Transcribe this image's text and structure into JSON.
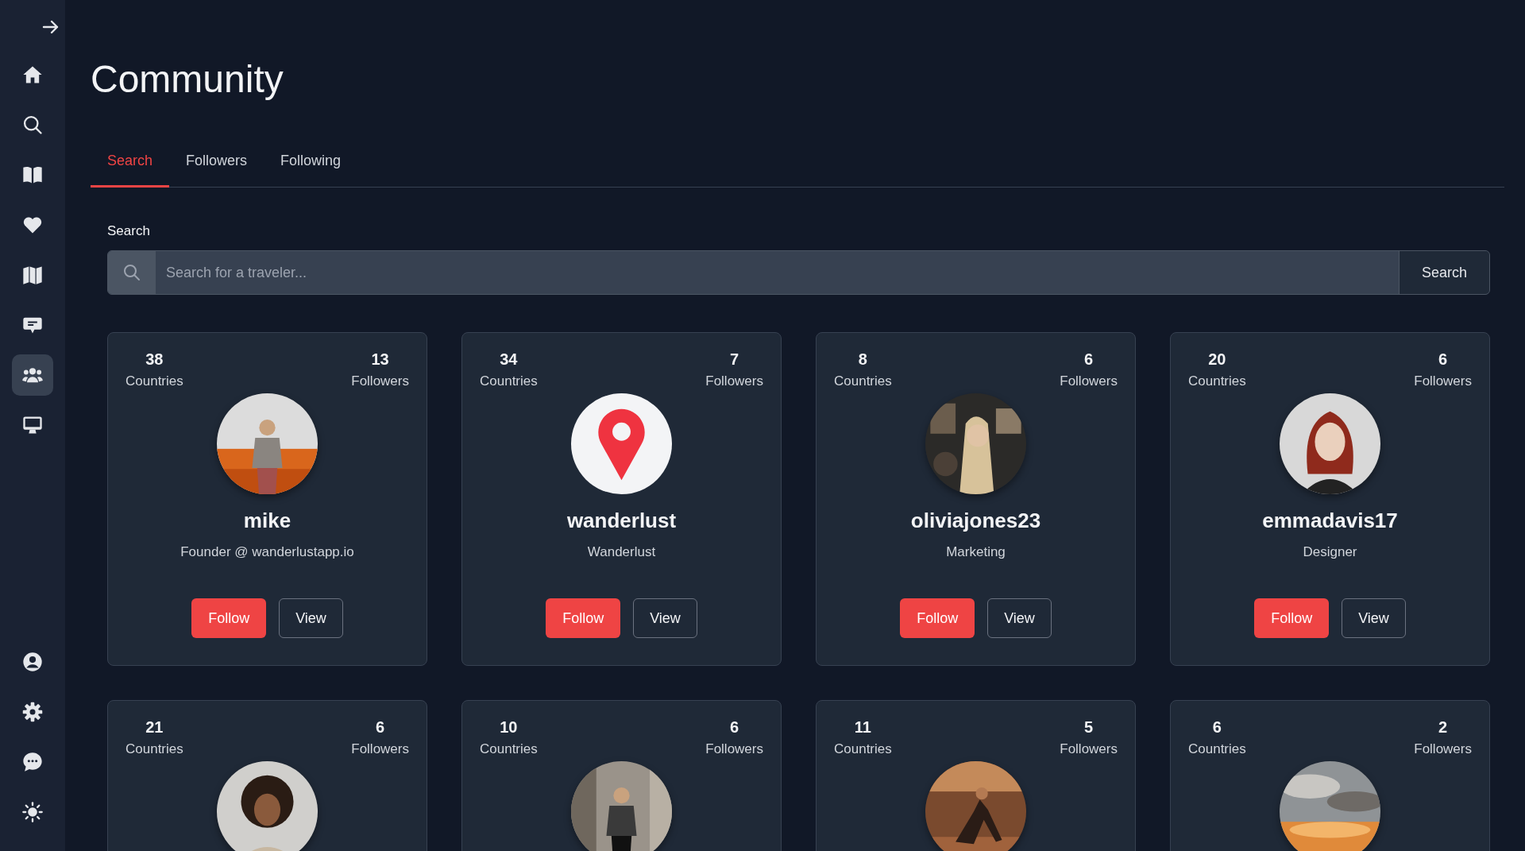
{
  "sidebar": {
    "items": [
      {
        "selected": false
      },
      {
        "selected": false
      },
      {
        "selected": false
      },
      {
        "selected": false
      },
      {
        "selected": false
      },
      {
        "selected": false
      },
      {
        "selected": true
      },
      {
        "selected": false
      }
    ]
  },
  "title": "Community",
  "tabs": [
    {
      "label": "Search",
      "selected": true
    },
    {
      "label": "Followers",
      "selected": false
    },
    {
      "label": "Following",
      "selected": false
    }
  ],
  "search": {
    "label": "Search",
    "placeholder": "Search for a traveler...",
    "button": "Search"
  },
  "users": [
    {
      "countries": "38",
      "countries_label": "Countries",
      "followers": "13",
      "followers_label": "Followers",
      "name": "mike",
      "subtitle": "Founder @ wanderlustapp.io",
      "follow": "Follow",
      "view": "View"
    },
    {
      "countries": "34",
      "countries_label": "Countries",
      "followers": "7",
      "followers_label": "Followers",
      "avatar": {
        "kind": "logo"
      },
      "name": "wanderlust",
      "subtitle": "Wanderlust",
      "follow": "Follow",
      "view": "View"
    },
    {
      "countries": "8",
      "countries_label": "Countries",
      "followers": "6",
      "followers_label": "Followers",
      "name": "oliviajones23",
      "subtitle": "Marketing",
      "follow": "Follow",
      "view": "View"
    },
    {
      "countries": "20",
      "countries_label": "Countries",
      "followers": "6",
      "followers_label": "Followers",
      "name": "emmadavis17",
      "subtitle": "Designer",
      "follow": "Follow",
      "view": "View"
    },
    {
      "countries": "21",
      "countries_label": "Countries",
      "followers": "6",
      "followers_label": "Followers"
    },
    {
      "countries": "10",
      "countries_label": "Countries",
      "followers": "6",
      "followers_label": "Followers"
    },
    {
      "countries": "11",
      "countries_label": "Countries",
      "followers": "5",
      "followers_label": "Followers"
    },
    {
      "countries": "6",
      "countries_label": "Countries",
      "followers": "2",
      "followers_label": "Followers"
    }
  ]
}
